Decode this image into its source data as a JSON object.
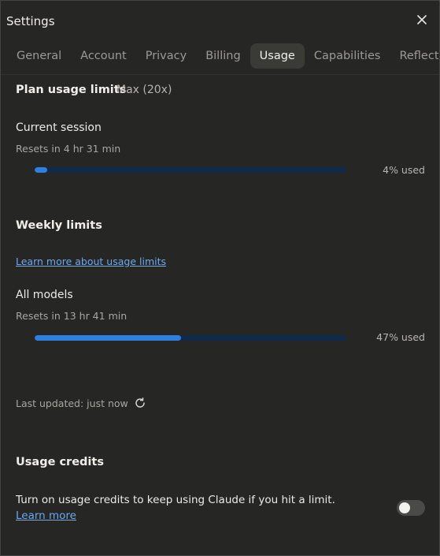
{
  "window": {
    "title": "Settings"
  },
  "tabs": [
    {
      "label": "General"
    },
    {
      "label": "Account"
    },
    {
      "label": "Privacy"
    },
    {
      "label": "Billing"
    },
    {
      "label": "Usage",
      "active": true
    },
    {
      "label": "Capabilities"
    },
    {
      "label": "Reflect"
    }
  ],
  "plan": {
    "heading": "Plan usage limits",
    "badge": "Max (20x)"
  },
  "current_session": {
    "label": "Current session",
    "resets": "Resets in 4 hr 31 min",
    "used_label": "4% used",
    "used_fraction": 0.04
  },
  "weekly": {
    "heading": "Weekly limits",
    "learn_more": "Learn more about usage limits",
    "all_models": {
      "label": "All models",
      "resets": "Resets in 13 hr 41 min",
      "used_label": "47% used",
      "used_fraction": 0.47
    }
  },
  "last_updated": "Last updated: just now",
  "credits": {
    "heading": "Usage credits",
    "text": "Turn on usage credits to keep using Claude if you hit a limit. ",
    "link": "Learn more",
    "enabled": false
  },
  "colors": {
    "accent": "#2f7fe0",
    "track": "#0f2a4a",
    "link": "#6ea8ec"
  },
  "icons": {
    "close": "close-icon",
    "refresh": "refresh-icon"
  }
}
